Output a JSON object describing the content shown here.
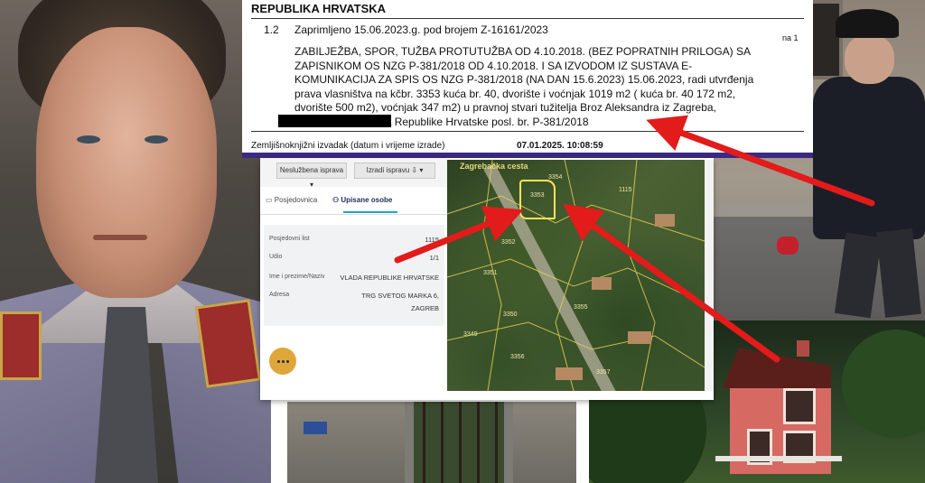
{
  "document": {
    "header": "REPUBLIKA HRVATSKA",
    "entry_number": "1.2",
    "entry_date": "Zaprimljeno 15.06.2023.g. pod brojem Z-16161/2023",
    "page_ref": "na 1",
    "body_lines": [
      "ZABILJEŽBA, SPOR, TUŽBA PROTUTUŽBA OD 4.10.2018. (BEZ POPRATNIH PRILOGA) SA",
      "ZAPISNIKOM OS NZG P-381/2018 OD 4.10.2018. I SA IZVODOM IZ SUSTAVA E-",
      "KOMUNIKACIJA ZA SPIS OS NZG P-381/2018 (NA DAN 15.6.2023) 15.06.2023, radi utvrđenja",
      "prava vlasništva na kčbr. 3353 kuća br. 40, dvorište i voćnjak 1019 m2 ( kuća br. 40 172 m2,",
      "dvorište 500 m2), voćnjak 347 m2) u pravnoj stvari tužitelja Broz Aleksandra iz Zagreba,",
      "               . i tuženika Republike Hrvatske posl. br. P-381/2018"
    ],
    "footer_label": "Zemljišnoknjižni izvadak (datum i vrijeme izrade)",
    "footer_datetime": "07.01.2025. 10:08:59"
  },
  "viewer": {
    "toolbar": {
      "left_button": "Neslužbena isprava ▾",
      "right_button": "Izradi ispravu ⇩ ▾"
    },
    "tabs": [
      {
        "label": "Posjedovnica",
        "active": false
      },
      {
        "label": "Upisane osobe",
        "active": true
      }
    ],
    "details": [
      {
        "label": "Posjedovni list",
        "value": "1115"
      },
      {
        "label": "Udio",
        "value": "1/1"
      },
      {
        "label": "Ime i prezime/Naziv",
        "value": "VLADA REPUBLIKE HRVATSKE"
      },
      {
        "label": "Adresa",
        "value": "TRG SVETOG MARKA 6,"
      },
      {
        "label": "",
        "value": "ZAGREB"
      }
    ],
    "map_label": "Zagrebačka cesta",
    "parcels": [
      "3353",
      "3354",
      "3352",
      "3351",
      "3350",
      "3356",
      "1115",
      "3349",
      "3355",
      "3357"
    ]
  },
  "colors": {
    "doc_border": "#3a2a82",
    "arrow": "#e21b1b",
    "tab_underline": "#24a3c4",
    "chat_button": "#e0a63a"
  }
}
